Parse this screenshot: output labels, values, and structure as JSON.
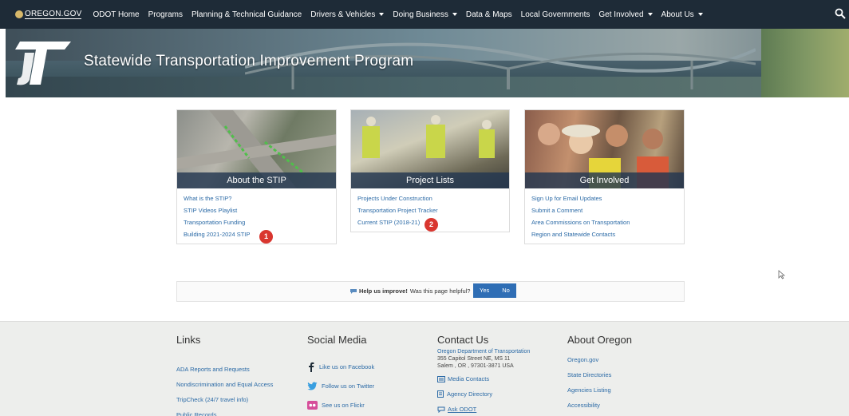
{
  "nav": {
    "brand": "OREGON.GOV",
    "items": [
      {
        "label": "ODOT Home",
        "dropdown": false
      },
      {
        "label": "Programs",
        "dropdown": false
      },
      {
        "label": "Planning & Technical Guidance",
        "dropdown": false
      },
      {
        "label": "Drivers & Vehicles",
        "dropdown": true
      },
      {
        "label": "Doing Business",
        "dropdown": true
      },
      {
        "label": "Data & Maps",
        "dropdown": false
      },
      {
        "label": "Local Governments",
        "dropdown": false
      },
      {
        "label": "Get Involved",
        "dropdown": true
      },
      {
        "label": "About Us",
        "dropdown": true
      }
    ],
    "search_icon": "search-icon"
  },
  "hero": {
    "title": "Statewide Transportation Improvement Program"
  },
  "cards": [
    {
      "caption": "About the STIP",
      "links": [
        "What is the STIP?",
        "STIP Videos Playlist",
        "Transportation Funding",
        "Building 2021-2024 STIP"
      ]
    },
    {
      "caption": "Project Lists",
      "links": [
        "Projects Under Construction",
        "Transportation Project Tracker",
        "Current STIP (2018-21)"
      ]
    },
    {
      "caption": "Get Involved",
      "links": [
        "Sign Up for Email Updates",
        "Submit a Comment",
        "Area Commissions on Transportation",
        "Region and Statewide Contacts"
      ]
    }
  ],
  "badges": [
    "1",
    "2"
  ],
  "feedback": {
    "bold": "Help us improve!",
    "question": "Was this page helpful?",
    "yes": "Yes",
    "no": "No"
  },
  "footer": {
    "links": {
      "title": "Links",
      "items": [
        "ADA Reports and Requests",
        "Nondiscrimination and Equal Access",
        "TripCheck (24/7 travel info)",
        "Public Records"
      ]
    },
    "social": {
      "title": "Social Media",
      "items": [
        "Like us on Facebook",
        "Follow us on Twitter",
        "See us on Flickr"
      ]
    },
    "contact": {
      "title": "Contact Us",
      "org": "Oregon Department of Transportation",
      "street": "355 Capitol Street NE, MS 11",
      "city": "Salem , OR , 97301-3871 USA",
      "items": [
        "Media Contacts",
        "Agency Directory",
        "Ask ODOT"
      ]
    },
    "about": {
      "title": "About Oregon",
      "items": [
        "Oregon.gov",
        "State Directories",
        "Agencies Listing",
        "Accessibility"
      ]
    }
  },
  "colors": {
    "nav_bg": "#1e2b37",
    "link": "#2b6aa6",
    "badge": "#d9362f",
    "button": "#2f6eb5"
  }
}
